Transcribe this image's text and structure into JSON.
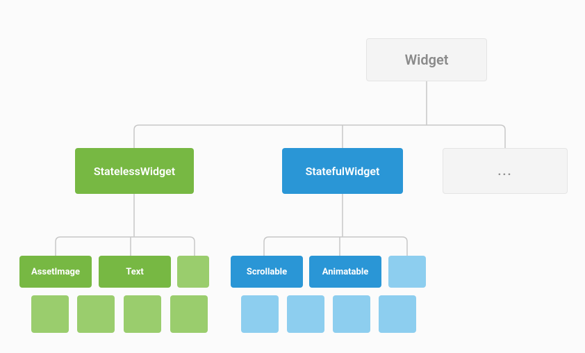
{
  "diagram": {
    "root": {
      "label": "Widget"
    },
    "branches": [
      {
        "label": "StatelessWidget",
        "color": "green",
        "children": [
          {
            "label": "AssetImage"
          },
          {
            "label": "Text"
          },
          {
            "label": ""
          }
        ],
        "row2_count": 4
      },
      {
        "label": "StatefulWidget",
        "color": "blue",
        "children": [
          {
            "label": "Scrollable"
          },
          {
            "label": "Animatable"
          },
          {
            "label": ""
          }
        ],
        "row2_count": 4
      },
      {
        "label": "...",
        "color": "placeholder",
        "children": [],
        "row2_count": 0
      }
    ]
  },
  "colors": {
    "green_main": "#77b843",
    "green_light": "#9acd6d",
    "blue_main": "#2a96d6",
    "blue_light": "#8dceef",
    "neutral_bg": "#f4f4f4",
    "neutral_border": "#e4e4e4",
    "neutral_text": "#8a8a8a",
    "connector": "#c7c7c7"
  }
}
